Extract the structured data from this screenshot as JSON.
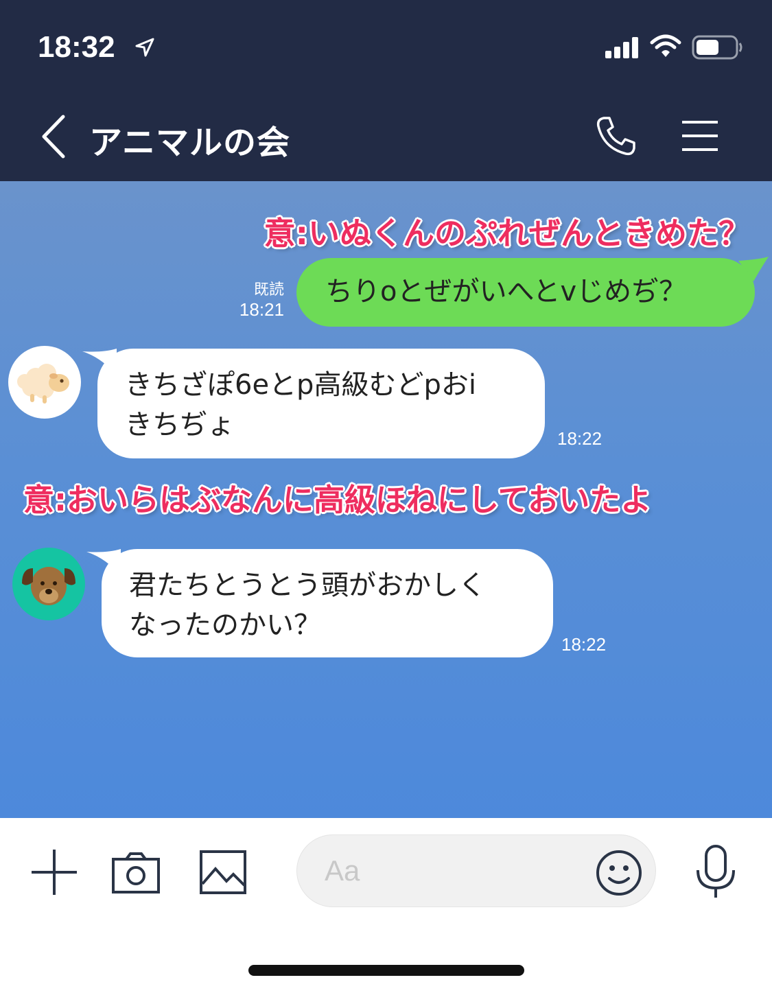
{
  "status_bar": {
    "time": "18:32"
  },
  "header": {
    "title": "アニマルの会"
  },
  "annotations": [
    "意:いぬくんのぷれぜんときめた？",
    "意:おいらはぶなんに高級ほねにしておいたよ"
  ],
  "messages": [
    {
      "direction": "outgoing",
      "text": "ちりoとぜがいへとvじめぢ？",
      "read_label": "既読",
      "time": "18:21"
    },
    {
      "direction": "incoming",
      "sender_avatar": "sheep-avatar",
      "line1": "きちざぽ6eとp高級むどpおi",
      "line2": "きちぢょ",
      "time": "18:22"
    },
    {
      "direction": "incoming",
      "sender_avatar": "dog-avatar",
      "line1": "君たちとうとう頭がおかしく",
      "line2": "なったのかい？",
      "time": "18:22"
    }
  ],
  "input": {
    "placeholder": "Aa"
  },
  "colors": {
    "header_bg": "#222b45",
    "chat_bg": "#5a8fd5",
    "outgoing_bubble": "#6ddb56",
    "incoming_bubble": "#ffffff",
    "annotation": "#ee2d5f"
  },
  "icons": [
    "location-arrow-icon",
    "signal-icon",
    "wifi-icon",
    "battery-icon",
    "back-chevron-icon",
    "phone-icon",
    "menu-icon",
    "plus-icon",
    "camera-icon",
    "image-icon",
    "emoji-icon",
    "microphone-icon"
  ]
}
